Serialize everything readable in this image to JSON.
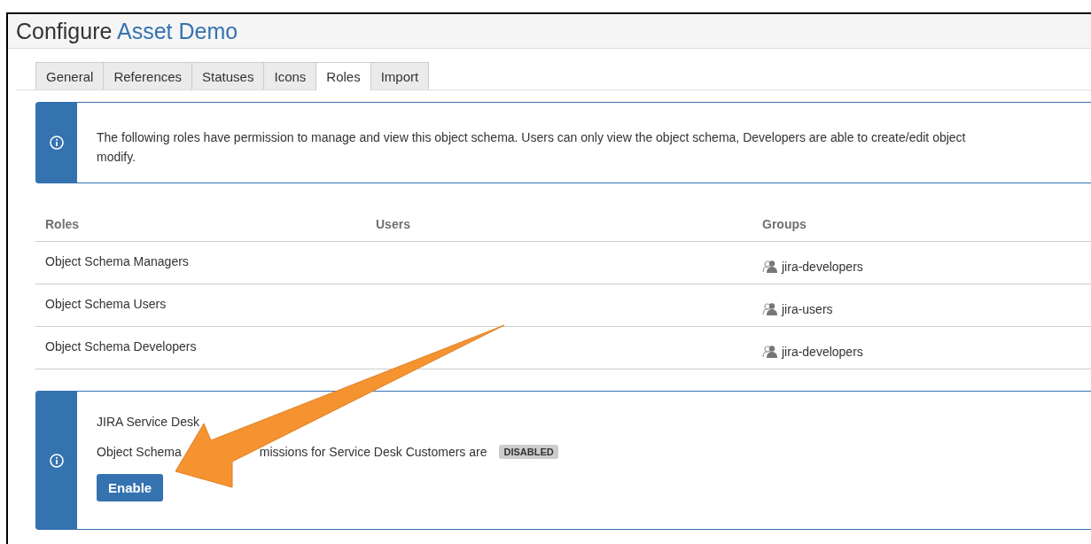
{
  "header": {
    "title_prefix": "Configure",
    "title_link": "Asset Demo"
  },
  "tabs": [
    {
      "label": "General",
      "selected": false
    },
    {
      "label": "References",
      "selected": false
    },
    {
      "label": "Statuses",
      "selected": false
    },
    {
      "label": "Icons",
      "selected": false
    },
    {
      "label": "Roles",
      "selected": true
    },
    {
      "label": "Import",
      "selected": false
    }
  ],
  "info": {
    "lines": [
      "The following roles have permission to manage and view this object schema. Users can only view the object schema, Developers are able to create/edit object",
      "modify."
    ]
  },
  "table": {
    "columns": [
      "Roles",
      "Users",
      "Groups"
    ],
    "rows": [
      {
        "role": "Object Schema Managers",
        "users": "",
        "group": "jira-developers"
      },
      {
        "role": "Object Schema Users",
        "users": "",
        "group": "jira-users"
      },
      {
        "role": "Object Schema Developers",
        "users": "",
        "group": "jira-developers"
      }
    ]
  },
  "service_desk": {
    "title": "JIRA Service Desk",
    "text_start": "Object Schema",
    "text_end": "missions for Service Desk Customers are",
    "status": "DISABLED",
    "button": "Enable"
  }
}
